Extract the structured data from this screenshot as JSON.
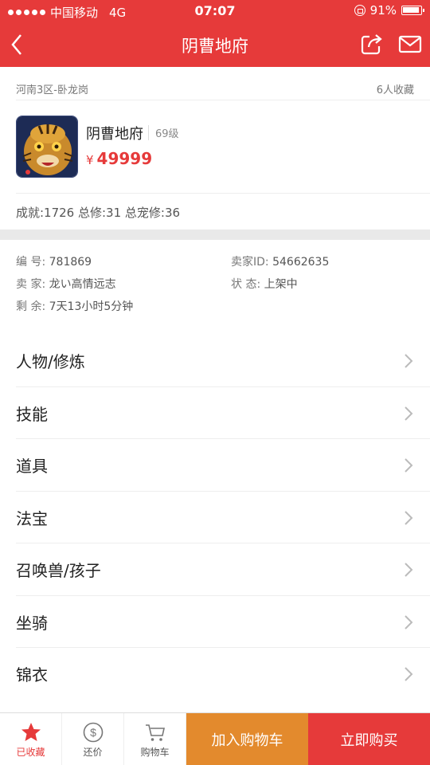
{
  "status": {
    "carrier": "中国移动",
    "network": "4G",
    "time": "07:07",
    "battery": "91%"
  },
  "nav": {
    "title": "阴曹地府"
  },
  "header": {
    "region": "河南3区-卧龙岗",
    "favorites": "6人收藏",
    "name": "阴曹地府",
    "level": "69级",
    "currency": "¥",
    "price": "49999",
    "stats": "成就:1726 总修:31 总宠修:36"
  },
  "info": {
    "id_label": "编 号:",
    "id_value": "781869",
    "seller_id_label": "卖家ID:",
    "seller_id_value": "54662635",
    "seller_label": "卖 家:",
    "seller_value": "龙い高情远志",
    "status_label": "状 态:",
    "status_value": "上架中",
    "remain_label": "剩 余:",
    "remain_value": "7天13小时5分钟"
  },
  "menu": [
    {
      "label": "人物/修炼"
    },
    {
      "label": "技能"
    },
    {
      "label": "道具"
    },
    {
      "label": "法宝"
    },
    {
      "label": "召唤兽/孩子"
    },
    {
      "label": "坐骑"
    },
    {
      "label": "锦衣"
    }
  ],
  "bottom": {
    "favorited": "已收藏",
    "bargain": "还价",
    "cart": "购物车",
    "add_to_cart": "加入购物车",
    "buy_now": "立即购买"
  },
  "colors": {
    "primary": "#e63a3a",
    "orange": "#e38a2d"
  }
}
